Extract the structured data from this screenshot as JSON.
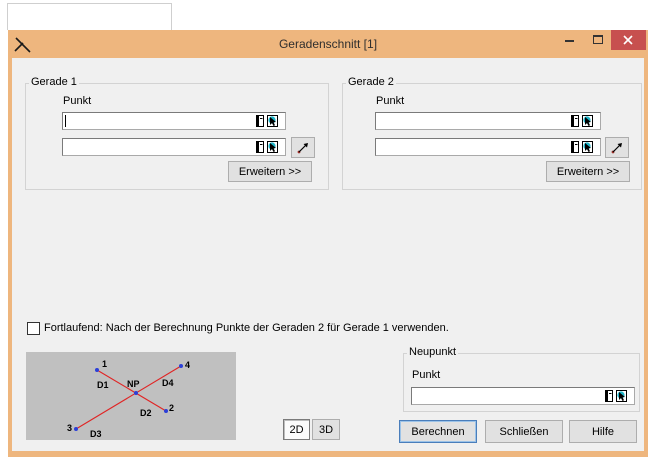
{
  "window": {
    "title": "Geradenschnitt [1]",
    "app_icon": "line-intersection-icon",
    "controls": [
      "minimize-icon",
      "maximize-icon",
      "close-icon"
    ]
  },
  "gerade1": {
    "legend": "Gerade 1",
    "punkt_label": "Punkt",
    "point1_value": "",
    "point2_value": "",
    "expand_button": "Erweitern >>",
    "direction_button_icon": "direction-arrow-icon"
  },
  "gerade2": {
    "legend": "Gerade 2",
    "punkt_label": "Punkt",
    "point1_value": "",
    "point2_value": "",
    "expand_button": "Erweitern >>",
    "direction_button_icon": "direction-arrow-icon"
  },
  "input_icons": [
    "document-icon",
    "cursor-pick-icon"
  ],
  "fortlaufend": {
    "label": "Fortlaufend: Nach der Berechnung Punkte der Geraden 2 für Gerade 1 verwenden.",
    "checked": false
  },
  "diagram": {
    "point_labels": [
      "1",
      "2",
      "3",
      "4"
    ],
    "segment_labels": [
      "D1",
      "D2",
      "D3",
      "D4"
    ],
    "intersection_label": "NP"
  },
  "view_mode": {
    "options": [
      "2D",
      "3D"
    ],
    "selected": "2D"
  },
  "neupunkt": {
    "legend": "Neupunkt",
    "punkt_label": "Punkt",
    "value": ""
  },
  "actions": {
    "calculate": "Berechnen",
    "close": "Schließen",
    "help": "Hilfe"
  },
  "colors": {
    "frame": "#EEB67E",
    "close_button": "#C7504F",
    "dialog_background": "#F0F0F0",
    "diagram_background": "#C0C0C0",
    "diagram_lines": "#E02424",
    "diagram_points": "#2B3FD8"
  }
}
